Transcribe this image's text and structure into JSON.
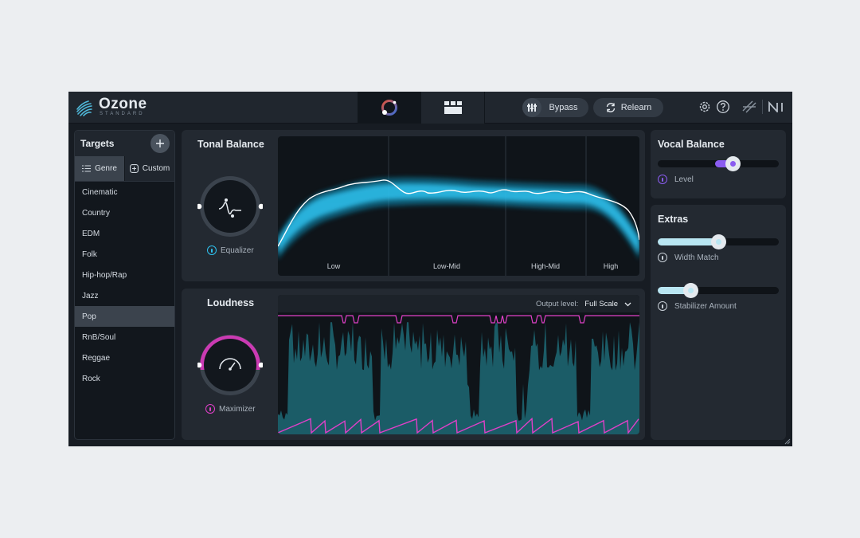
{
  "app": {
    "brand": "Ozone",
    "edition": "STANDARD"
  },
  "topbar": {
    "bypass_label": "Bypass",
    "relearn_label": "Relearn"
  },
  "targets": {
    "title": "Targets",
    "tabs": [
      {
        "label": "Genre",
        "active": true
      },
      {
        "label": "Custom",
        "active": false
      }
    ],
    "genres": [
      "Cinematic",
      "Country",
      "EDM",
      "Folk",
      "Hip-hop/Rap",
      "Jazz",
      "Pop",
      "RnB/Soul",
      "Reggae",
      "Rock"
    ],
    "selected": "Pop"
  },
  "tonal_balance": {
    "title": "Tonal Balance",
    "module_label": "Equalizer",
    "bands": [
      "Low",
      "Low-Mid",
      "High-Mid",
      "High"
    ]
  },
  "loudness": {
    "title": "Loudness",
    "module_label": "Maximizer",
    "output_level_label": "Output level:",
    "output_level_value": "Full Scale"
  },
  "vocal_balance": {
    "title": "Vocal Balance",
    "level_label": "Level",
    "level_value": 0.62
  },
  "extras": {
    "title": "Extras",
    "width_match_label": "Width Match",
    "width_match_value": 0.5,
    "stabilizer_label": "Stabilizer Amount",
    "stabilizer_value": 0.27
  },
  "colors": {
    "tonal_accent": "#2ec1ee",
    "loudness_accent": "#e040c8",
    "vocal_accent": "#8a5cf0",
    "extras_accent": "#b9e6f2"
  }
}
